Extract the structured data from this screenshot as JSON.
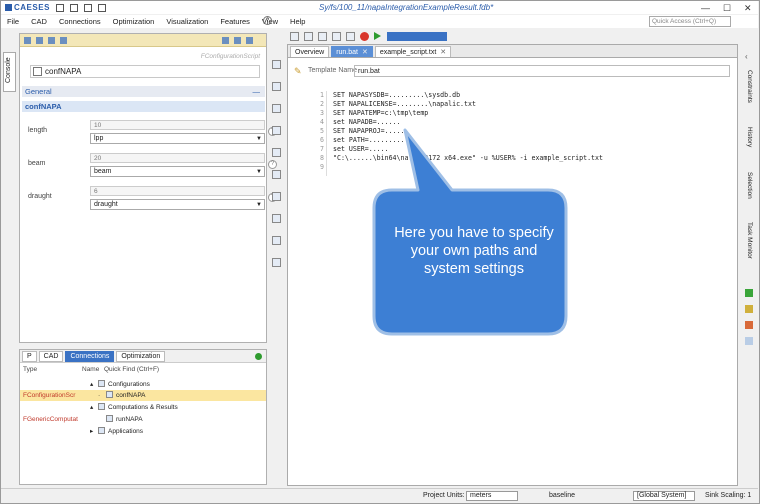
{
  "titlebar": {
    "app_name": "CAESES",
    "file_title": "Sy/fs/100_11/napaIntegrationExampleResult.fdb*",
    "minimize": "—",
    "maximize": "☐",
    "close": "✕"
  },
  "menubar": {
    "items": [
      "File",
      "CAD",
      "Connections",
      "Optimization",
      "Visualization",
      "Features",
      "View",
      "Help"
    ],
    "help_icon": "?",
    "quick_access_placeholder": "Quick Access (Ctrl+Q)"
  },
  "left_vtab": {
    "label": "Console"
  },
  "properties": {
    "caption": "FConfigurationScript",
    "name_value": "confNAPA",
    "section_general": "General",
    "section_object": "confNAPA",
    "chevron": "—",
    "fields": [
      {
        "label": "length",
        "number": "10",
        "select": "lpp"
      },
      {
        "label": "beam",
        "number": "20",
        "select": "beam"
      },
      {
        "label": "draught",
        "number": "6",
        "select": "draught"
      }
    ],
    "help_glyph": "?"
  },
  "tree": {
    "tabs": [
      "P",
      "CAD",
      "Connections",
      "Optimization"
    ],
    "active_tab": "Connections",
    "head": {
      "type": "Type",
      "name": "Name",
      "quickfind": "Quick Find (Ctrl+F)"
    },
    "rows": [
      {
        "type": "",
        "node": "Configurations",
        "indent": 1,
        "selected": false
      },
      {
        "type": "FConfigurationScr",
        "node": "confNAPA",
        "indent": 2,
        "selected": true
      },
      {
        "type": "",
        "node": "Computations & Results",
        "indent": 1,
        "selected": false
      },
      {
        "type": "FGenericComputat",
        "node": "runNAPA",
        "indent": 2,
        "selected": false
      },
      {
        "type": "",
        "node": "Applications",
        "indent": 1,
        "selected": false
      }
    ]
  },
  "editor": {
    "tabs": [
      {
        "label": "Overview",
        "active": false
      },
      {
        "label": "run.bat",
        "active": true
      },
      {
        "label": "example_script.txt",
        "active": false
      }
    ],
    "close_glyph": "✕",
    "template_label": "Template Name",
    "template_value": "run.bat",
    "lines": [
      {
        "n": "1",
        "text": "SET NAPASYSDB=.........\\sysdb.db"
      },
      {
        "n": "2",
        "text": "SET NAPALICENSE=........\\napalic.txt"
      },
      {
        "n": "3",
        "text": "SET NAPATEMP=c:\\tmp\\temp"
      },
      {
        "n": "4",
        "text": "set NAPADB=......"
      },
      {
        "n": "5",
        "text": "SET NAPAPROJ=......"
      },
      {
        "n": "6",
        "text": "set PATH=..........."
      },
      {
        "n": "7",
        "text": "set USER=....."
      },
      {
        "n": "8",
        "text": "\"C:\\......\\bin64\\na...20172 x64.exe\" -u %USER% -i example_script.txt"
      },
      {
        "n": "9",
        "text": ""
      }
    ]
  },
  "callout": {
    "text": "Here you have to specify your own paths and system settings",
    "fill": "#3d7fd4",
    "stroke": "#9fbfe6"
  },
  "right_tabs": [
    "Constraints",
    "History",
    "Selection",
    "Task Monitor"
  ],
  "status": {
    "project_units_label": "Project Units:",
    "project_units_value": "meters",
    "baseline_label": "baseline",
    "global_system": "[Global System]",
    "sink_scaling": "Sink Scaling: 1"
  }
}
